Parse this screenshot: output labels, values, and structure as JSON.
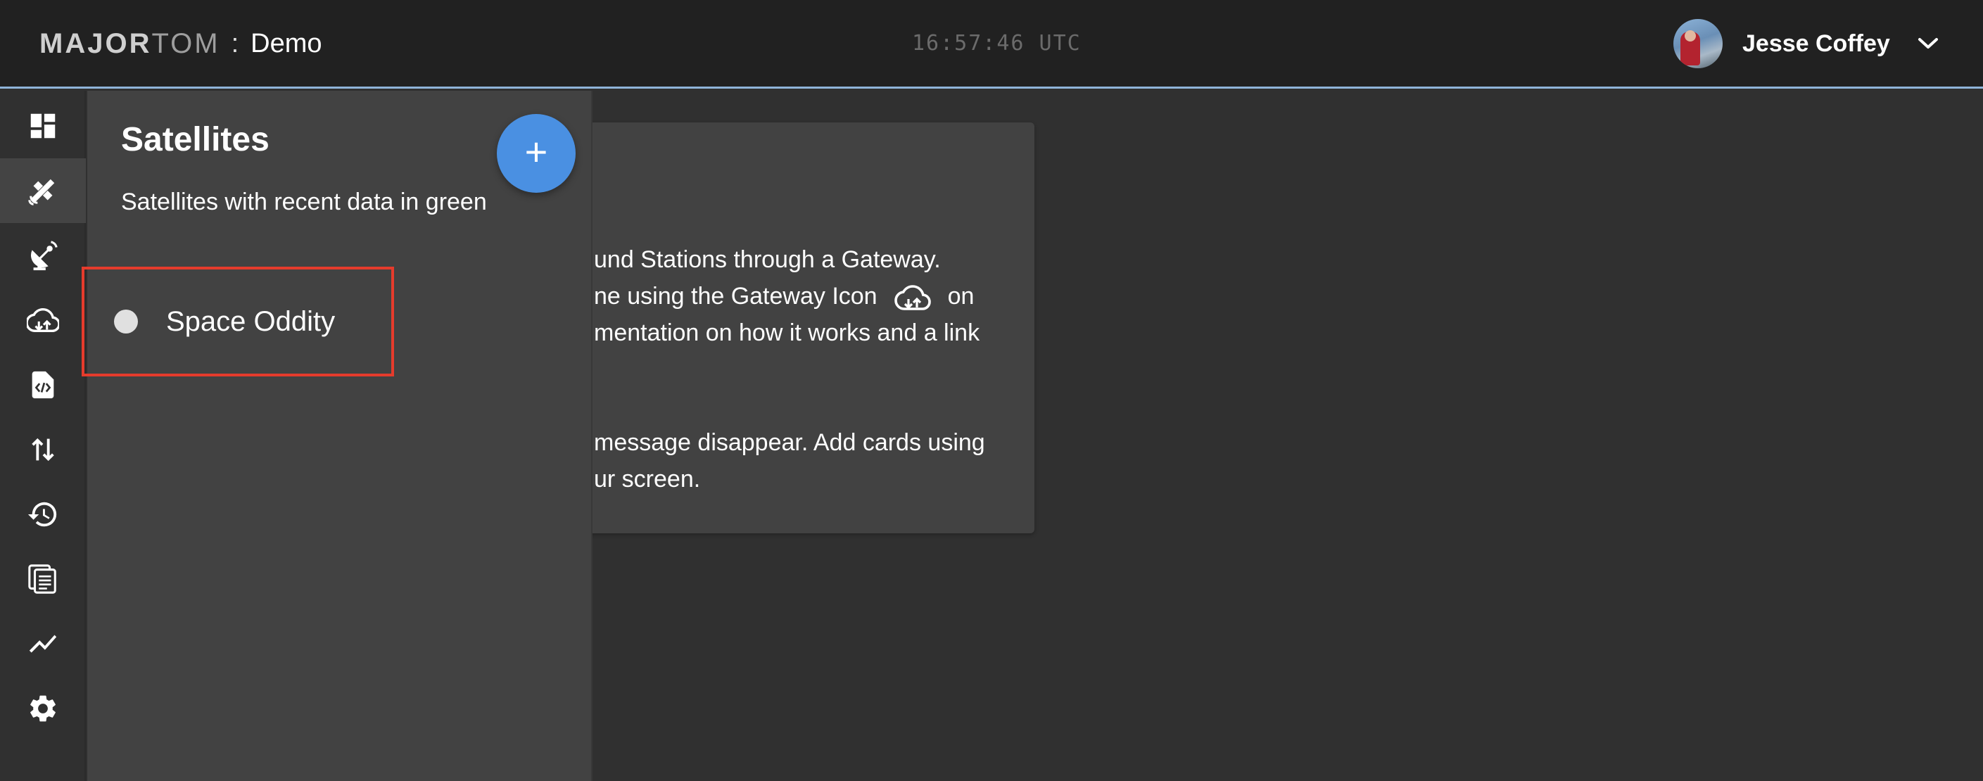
{
  "header": {
    "brand_major": "MAJOR",
    "brand_tom": "TOM",
    "brand_separator": ":",
    "workspace": "Demo",
    "clock": "16:57:46 UTC",
    "user_name": "Jesse Coffey"
  },
  "rail": {
    "items": [
      {
        "icon": "dashboard-icon",
        "active": false
      },
      {
        "icon": "satellite-icon",
        "active": true
      },
      {
        "icon": "ground-station-icon",
        "active": false
      },
      {
        "icon": "gateway-cloud-icon",
        "active": false
      },
      {
        "icon": "code-file-icon",
        "active": false
      },
      {
        "icon": "transfer-arrows-icon",
        "active": false
      },
      {
        "icon": "history-icon",
        "active": false
      },
      {
        "icon": "documents-icon",
        "active": false
      },
      {
        "icon": "trend-chart-icon",
        "active": false
      },
      {
        "icon": "settings-icon",
        "active": false
      }
    ]
  },
  "drawer": {
    "title": "Satellites",
    "subtitle": "Satellites with recent data in green",
    "add_button": "+",
    "satellites": [
      {
        "name": "Space Oddity",
        "status_color": "#e0e0e0"
      }
    ]
  },
  "card": {
    "line1": "und Stations through a Gateway.",
    "line2a": "ne using the Gateway Icon",
    "line2b": "on",
    "line3": "mentation on how it works and a link",
    "line4": "message disappear. Add cards using",
    "line5": "ur screen."
  },
  "colors": {
    "accent_blue": "#4a90e2",
    "highlight_red": "#e53b2c",
    "topbar_bg": "#212121",
    "drawer_bg": "#424242"
  }
}
